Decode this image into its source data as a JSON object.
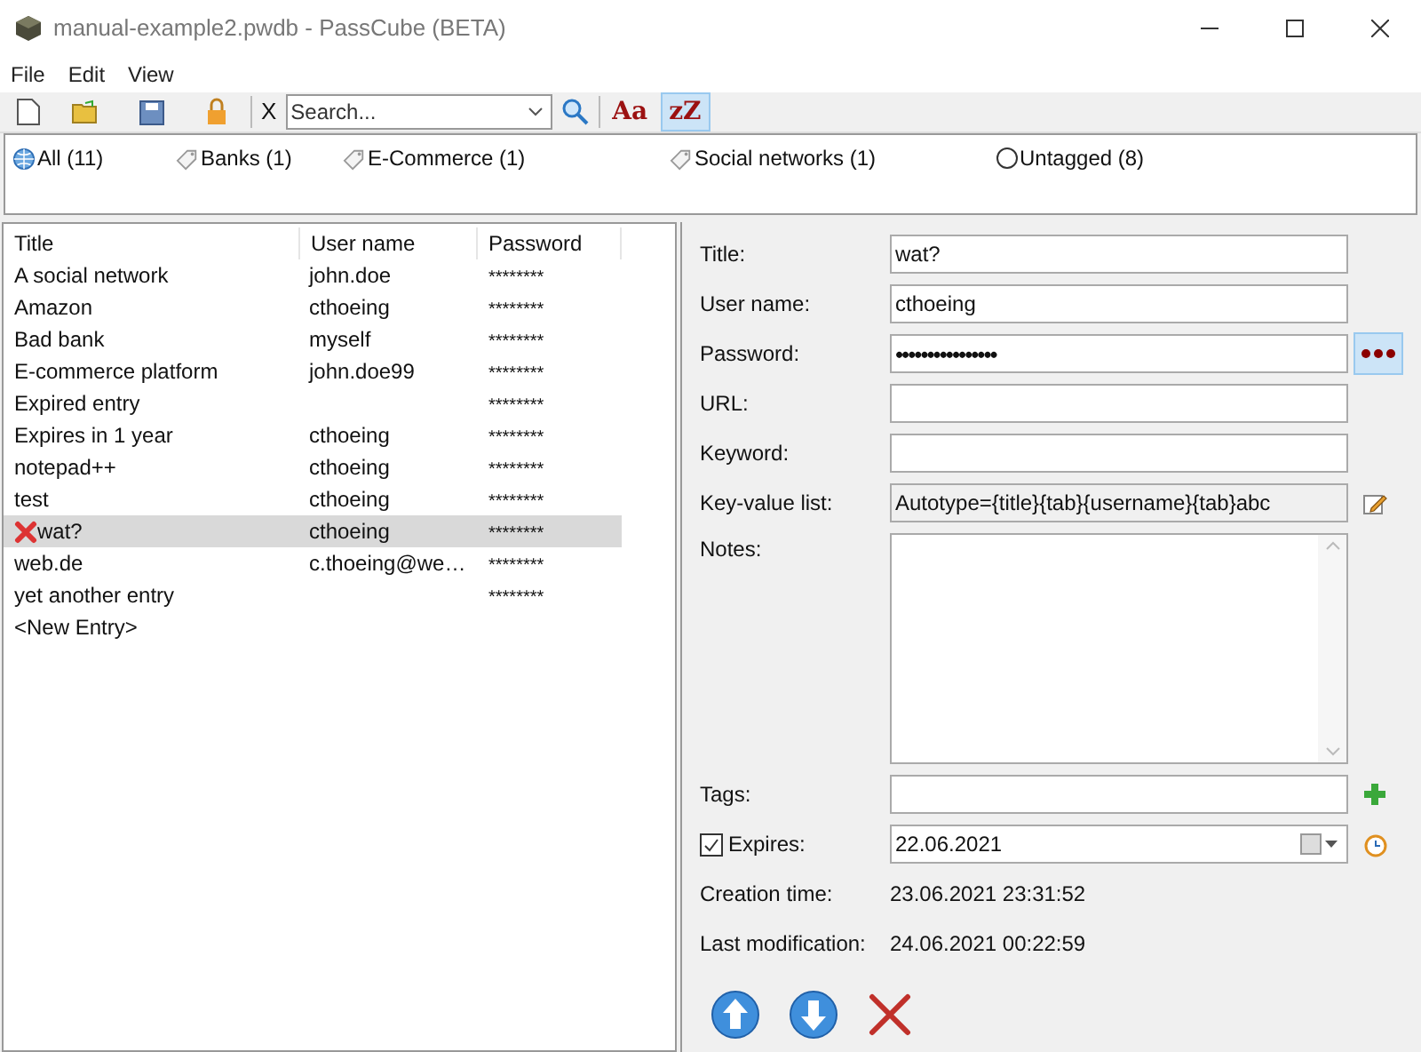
{
  "window": {
    "title": "manual-example2.pwdb - PassCube (BETA)"
  },
  "menu": [
    "File",
    "Edit",
    "View"
  ],
  "toolbar": {
    "clear_label": "X",
    "search": {
      "placeholder": "Search..."
    },
    "toggles": [
      {
        "label": "Aa",
        "selected": false
      },
      {
        "label": "zZ",
        "selected": true
      }
    ]
  },
  "tags": [
    {
      "kind": "all",
      "label": "All (11)"
    },
    {
      "kind": "tag",
      "label": "Banks (1)"
    },
    {
      "kind": "tag",
      "label": "E-Commerce (1)"
    },
    {
      "kind": "tag",
      "label": "Social networks (1)"
    },
    {
      "kind": "untagged",
      "label": "Untagged (8)"
    }
  ],
  "table": {
    "columns": [
      "Title",
      "User name",
      "Password"
    ],
    "rows": [
      {
        "title": "A social network",
        "user": "john.doe",
        "password": "********",
        "selected": false,
        "flagged": false
      },
      {
        "title": "Amazon",
        "user": "cthoeing",
        "password": "********",
        "selected": false,
        "flagged": false
      },
      {
        "title": "Bad bank",
        "user": "myself",
        "password": "********",
        "selected": false,
        "flagged": false
      },
      {
        "title": "E-commerce platform",
        "user": "john.doe99",
        "password": "********",
        "selected": false,
        "flagged": false
      },
      {
        "title": "Expired entry",
        "password": "********",
        "selected": false,
        "flagged": false
      },
      {
        "title": "Expires in 1 year",
        "user": "cthoeing",
        "password": "********",
        "selected": false,
        "flagged": false
      },
      {
        "title": "notepad++",
        "user": "cthoeing",
        "password": "********",
        "selected": false,
        "flagged": false
      },
      {
        "title": "test",
        "user": "cthoeing",
        "password": "********",
        "selected": false,
        "flagged": false
      },
      {
        "title": "wat?",
        "user": "cthoeing",
        "password": "********",
        "selected": true,
        "flagged": true
      },
      {
        "title": "web.de",
        "user": "c.thoeing@we…",
        "password": "********",
        "selected": false,
        "flagged": false
      },
      {
        "title": "yet another entry",
        "password": "********",
        "selected": false,
        "flagged": false
      }
    ],
    "new_entry": "<New Entry>"
  },
  "details": {
    "fields": [
      {
        "label": "Title:",
        "value": "wat?",
        "kind": "text"
      },
      {
        "label": "User name:",
        "value": "cthoeing",
        "kind": "text"
      },
      {
        "label": "Password:",
        "value": "••••••••••••••••",
        "kind": "password"
      },
      {
        "label": "URL:",
        "kind": "text"
      },
      {
        "label": "Keyword:",
        "kind": "text"
      },
      {
        "label": "Key-value list:",
        "value": "Autotype={title}{tab}{username}{tab}abc",
        "kind": "keyvalue"
      },
      {
        "label": "Notes:",
        "kind": "notes"
      },
      {
        "label": "Tags:",
        "kind": "tags"
      }
    ],
    "expires": {
      "label": "Expires:",
      "checked": true,
      "value": "22.06.2021"
    },
    "info": [
      {
        "label": "Creation time:",
        "value": "23.06.2021 23:31:52"
      },
      {
        "label": "Last modification:",
        "value": "24.06.2021 00:22:59"
      }
    ]
  }
}
